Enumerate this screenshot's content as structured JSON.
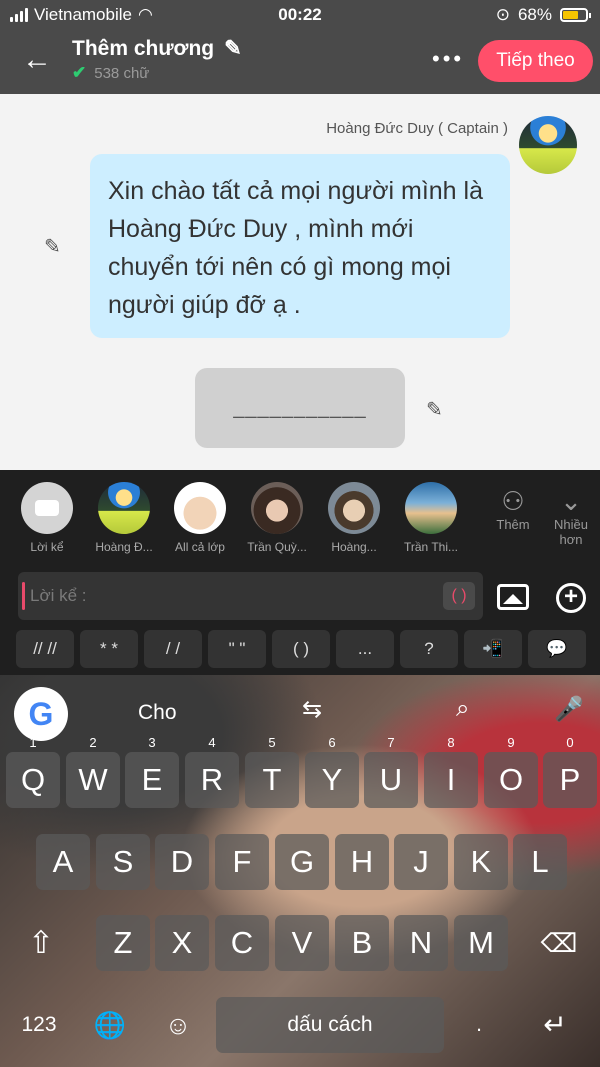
{
  "status": {
    "carrier": "Vietnamobile",
    "time": "00:22",
    "battery": "68%"
  },
  "header": {
    "title": "Thêm chương",
    "word_count": "538 chữ",
    "next_label": "Tiếp theo",
    "more_label": "•••",
    "back_icon": "arrow-left-icon"
  },
  "chat": {
    "speaker": "Hoàng Đức Duy ( Captain )",
    "message": "Xin chào tất cả mọi người mình là Hoàng Đức Duy , mình mới chuyển tới nên có gì mong mọi người giúp đỡ ạ .",
    "placeholder": "___________"
  },
  "characters": [
    {
      "name": "Lời kể"
    },
    {
      "name": "Hoàng Đ..."
    },
    {
      "name": "All cả lớp"
    },
    {
      "name": "Trần Quỳ..."
    },
    {
      "name": "Hoàng..."
    },
    {
      "name": "Trần Thi..."
    }
  ],
  "side_buttons": {
    "add": "Thêm",
    "more": "Nhiều hơn"
  },
  "input": {
    "placeholder": "Lời kể :",
    "paren_button": "( )"
  },
  "symbols": [
    "// //",
    "* *",
    "/ /",
    "\" \"",
    "( )",
    "...",
    "?",
    "📲",
    "💬"
  ],
  "keyboard": {
    "suggestion": "Cho",
    "row1": [
      "Q",
      "W",
      "E",
      "R",
      "T",
      "Y",
      "U",
      "I",
      "O",
      "P"
    ],
    "row1_nums": [
      "1",
      "2",
      "3",
      "4",
      "5",
      "6",
      "7",
      "8",
      "9",
      "0"
    ],
    "row2": [
      "A",
      "S",
      "D",
      "F",
      "G",
      "H",
      "J",
      "K",
      "L"
    ],
    "row3": [
      "Z",
      "X",
      "C",
      "V",
      "B",
      "N",
      "M"
    ],
    "num_key": "123",
    "space": "dấu cách",
    "period": "."
  }
}
